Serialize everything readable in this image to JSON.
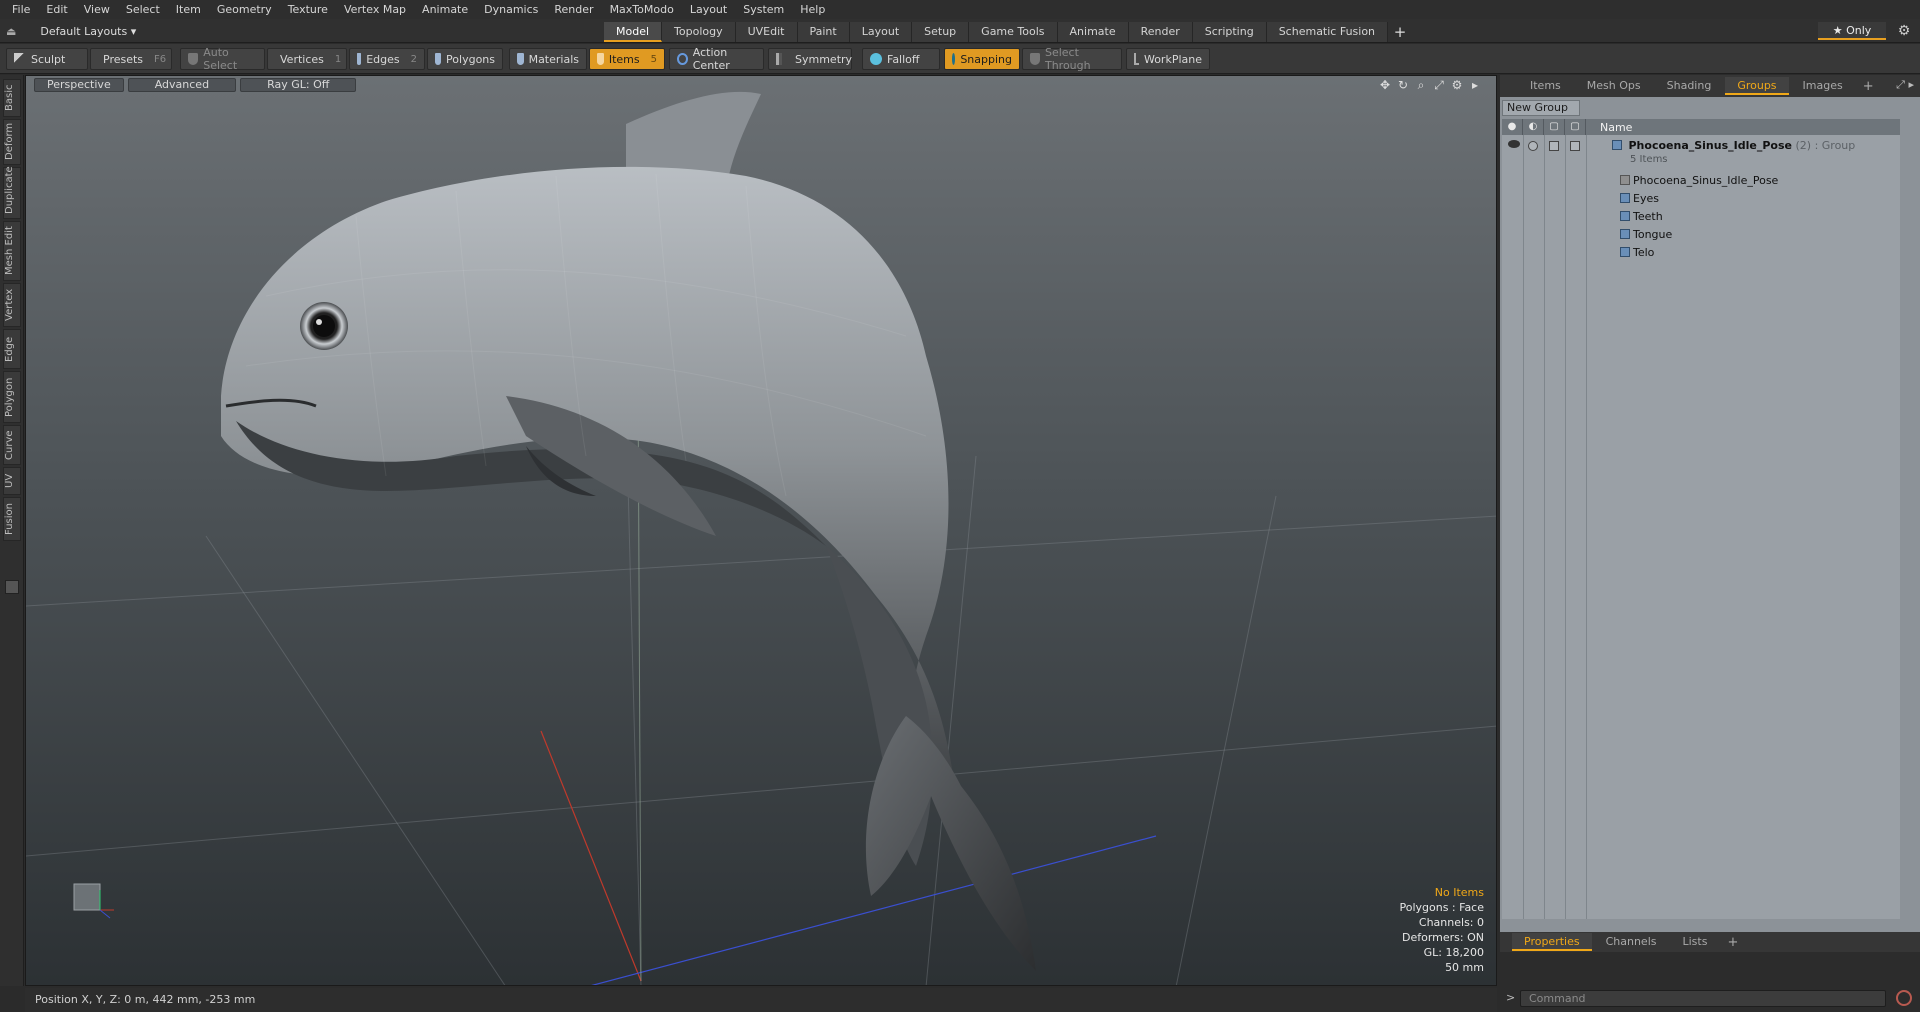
{
  "menu": [
    "File",
    "Edit",
    "View",
    "Select",
    "Item",
    "Geometry",
    "Texture",
    "Vertex Map",
    "Animate",
    "Dynamics",
    "Render",
    "MaxToModo",
    "Layout",
    "System",
    "Help"
  ],
  "layouts": {
    "label": "Default Layouts ▾"
  },
  "tabs": [
    "Model",
    "Topology",
    "UVEdit",
    "Paint",
    "Layout",
    "Setup",
    "Game Tools",
    "Animate",
    "Render",
    "Scripting",
    "Schematic Fusion"
  ],
  "active_tab": "Model",
  "only_button": "★ Only",
  "toolbar": {
    "sculpt": "Sculpt",
    "presets": "Presets",
    "presets_key": "F6",
    "auto_select": "Auto Select",
    "vertices": "Vertices",
    "vertices_key": "1",
    "edges": "Edges",
    "edges_key": "2",
    "polygons": "Polygons",
    "materials": "Materials",
    "items": "Items",
    "items_key": "5",
    "action_center": "Action Center",
    "symmetry": "Symmetry",
    "falloff": "Falloff",
    "snapping": "Snapping",
    "select_through": "Select Through",
    "workplane": "WorkPlane"
  },
  "left_tabs": [
    "Basic",
    "Deform",
    "Duplicate",
    "Mesh Edit",
    "Vertex",
    "Edge",
    "Polygon",
    "Curve",
    "UV",
    "Fusion"
  ],
  "viewport": {
    "perspective": "Perspective",
    "advanced": "Advanced",
    "raygl": "Ray GL: Off",
    "info": {
      "no_items": "No Items",
      "polygons": "Polygons : Face",
      "channels": "Channels: 0",
      "deformers": "Deformers: ON",
      "gl": "GL: 18,200",
      "mm": "50 mm"
    }
  },
  "status": {
    "position": "Position X, Y, Z:  0 m, 442 mm, -253 mm"
  },
  "right_panel": {
    "tabs": [
      "Items",
      "Mesh Ops",
      "Shading",
      "Groups",
      "Images"
    ],
    "active_tab": "Groups",
    "new_group": "New Group",
    "name_header": "Name",
    "group": {
      "name": "Phocoena_Sinus_Idle_Pose",
      "meta": "(2) : Group",
      "count": "5 Items"
    },
    "children": [
      "Phocoena_Sinus_Idle_Pose",
      "Eyes",
      "Teeth",
      "Tongue",
      "Telo"
    ],
    "bottom_tabs": [
      "Properties",
      "Channels",
      "Lists"
    ],
    "bottom_active": "Properties",
    "command_placeholder": "Command"
  },
  "colors": {
    "accent": "#e09a22",
    "viewport_top": "#6b7074",
    "viewport_bottom": "#2c3134"
  }
}
